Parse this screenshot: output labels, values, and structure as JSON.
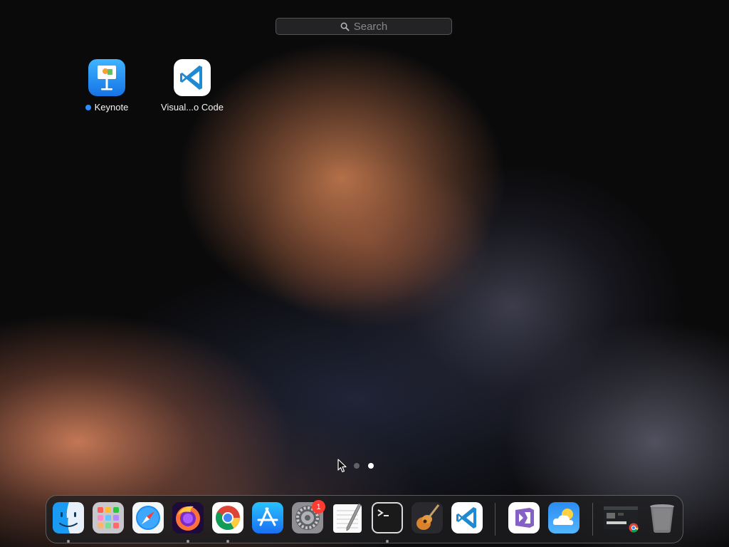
{
  "search": {
    "placeholder": "Search"
  },
  "apps": [
    {
      "name": "Keynote",
      "icon": "keynote-icon",
      "new": true
    },
    {
      "name": "Visual...o Code",
      "icon": "vscode-icon",
      "new": false
    }
  ],
  "pages": {
    "count": 2,
    "current": 2
  },
  "dock": {
    "items": [
      {
        "name": "Finder",
        "icon": "finder-icon",
        "running": true
      },
      {
        "name": "Launchpad",
        "icon": "launchpad-icon",
        "running": false
      },
      {
        "name": "Safari",
        "icon": "safari-icon",
        "running": false
      },
      {
        "name": "Firefox",
        "icon": "firefox-icon",
        "running": true
      },
      {
        "name": "Google Chrome",
        "icon": "chrome-icon",
        "running": true
      },
      {
        "name": "App Store",
        "icon": "app-store-icon",
        "running": false
      },
      {
        "name": "System Preferences",
        "icon": "system-preferences-icon",
        "running": false,
        "badge": "1"
      },
      {
        "name": "TextEdit",
        "icon": "textedit-icon",
        "running": false
      },
      {
        "name": "Terminal",
        "icon": "terminal-icon",
        "running": true
      },
      {
        "name": "GarageBand",
        "icon": "garageband-icon",
        "running": false
      },
      {
        "name": "Visual Studio Code",
        "icon": "vscode-icon",
        "running": false
      },
      {
        "name": "Visual Studio",
        "icon": "visual-studio-icon",
        "running": false
      },
      {
        "name": "Weather",
        "icon": "weather-icon",
        "running": false
      },
      {
        "name": "Chrome Window",
        "icon": "chrome-window-thumbnail-icon",
        "running": false
      },
      {
        "name": "Trash",
        "icon": "trash-icon",
        "running": false
      }
    ]
  },
  "colors": {
    "accent": "#2d8cff",
    "badge": "#ff3b30"
  }
}
